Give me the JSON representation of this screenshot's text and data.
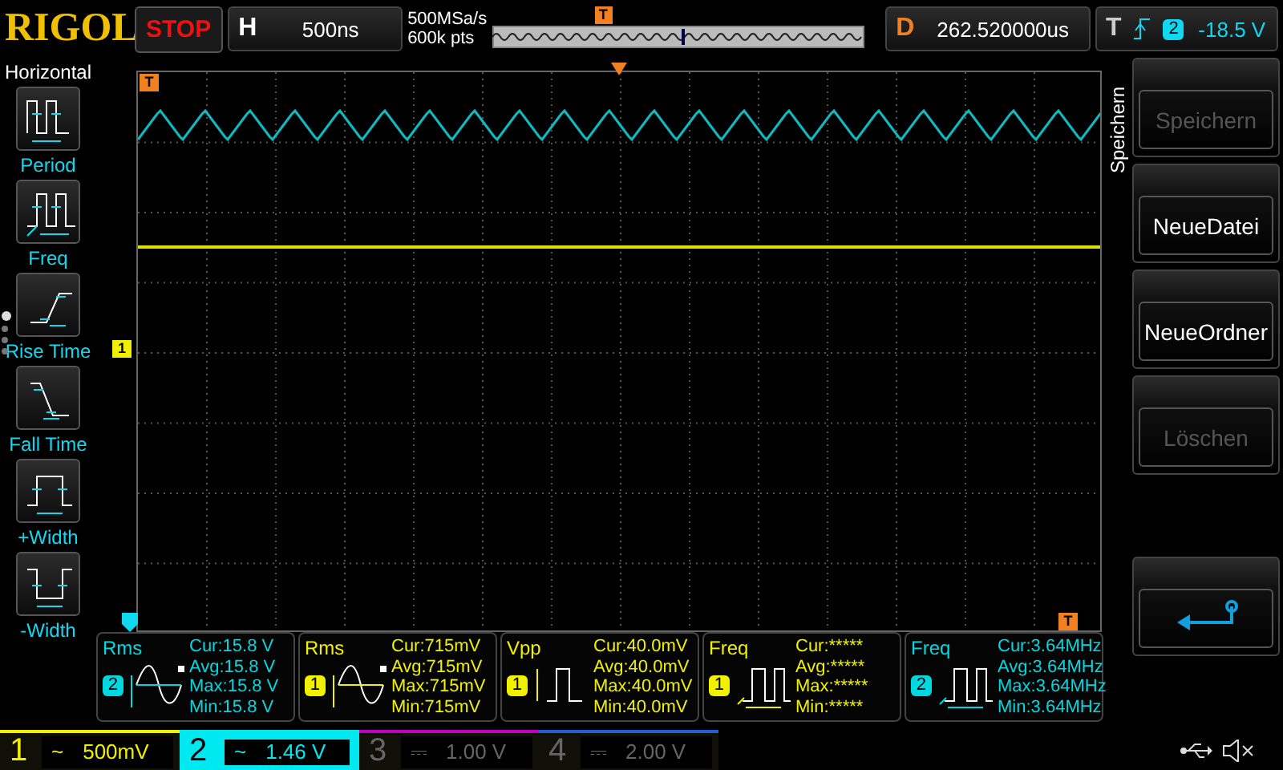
{
  "top_bar": {
    "brand": "RIGOL",
    "run_state": "STOP",
    "timebase": {
      "label": "H",
      "value": "500ns"
    },
    "sample_rate": "500MSa/s",
    "memory_depth": "600k pts",
    "overview_marker": "T",
    "delay": {
      "label": "D",
      "value": "262.520000us"
    },
    "trigger": {
      "label": "T",
      "source": "2",
      "level": "-18.5 V"
    }
  },
  "left_menu": {
    "title": "Horizontal",
    "items": [
      {
        "kind": "period",
        "label": "Period"
      },
      {
        "kind": "freq",
        "label": "Freq"
      },
      {
        "kind": "rise",
        "label": "Rise Time"
      },
      {
        "kind": "fall",
        "label": "Fall Time"
      },
      {
        "kind": "pwidth",
        "label": "+Width"
      },
      {
        "kind": "nwidth",
        "label": "-Width"
      }
    ],
    "pages": [
      {
        "selected": true
      },
      {
        "selected": false
      },
      {
        "selected": false
      },
      {
        "selected": false
      }
    ]
  },
  "grid": {
    "markers": [
      {
        "kind": "trigger",
        "label": "T"
      },
      {
        "kind": "channel",
        "label": "1",
        "color": "#f0f000"
      },
      {
        "kind": "trigger_level",
        "label": "T"
      }
    ]
  },
  "measurements": [
    {
      "kind": "rms",
      "name": "Rms",
      "channel": "2",
      "color": "#00d8e0",
      "cur": "Cur:15.8 V",
      "avg": "Avg:15.8 V",
      "max": "Max:15.8 V",
      "min": "Min:15.8 V"
    },
    {
      "kind": "rms",
      "name": "Rms",
      "channel": "1",
      "color": "#f0f000",
      "cur": "Cur:715mV",
      "avg": "Avg:715mV",
      "max": "Max:715mV",
      "min": "Min:715mV"
    },
    {
      "kind": "vpp",
      "name": "Vpp",
      "channel": "1",
      "color": "#f0f000",
      "cur": "Cur:40.0mV",
      "avg": "Avg:40.0mV",
      "max": "Max:40.0mV",
      "min": "Min:40.0mV"
    },
    {
      "kind": "freq",
      "name": "Freq",
      "channel": "1",
      "color": "#f0f000",
      "cur": "Cur:*****",
      "avg": "Avg:*****",
      "max": "Max:*****",
      "min": "Min:*****"
    },
    {
      "kind": "freq",
      "name": "Freq",
      "channel": "2",
      "color": "#00d8e0",
      "cur": "Cur:3.64MHz",
      "avg": "Avg:3.64MHz",
      "max": "Max:3.64MHz",
      "min": "Min:3.64MHz"
    }
  ],
  "right_menu": {
    "title": "Speichern",
    "buttons": [
      {
        "label": "Speichern",
        "disabled": true
      },
      {
        "label": "NeueDatei",
        "disabled": false
      },
      {
        "label": "NeueOrdner",
        "disabled": false
      },
      {
        "label": "Löschen",
        "disabled": true
      }
    ]
  },
  "channels": [
    {
      "number": "1",
      "coupling": "~",
      "scale": "500mV",
      "color": "#f0f000",
      "on": true,
      "selected": false
    },
    {
      "number": "2",
      "coupling": "~",
      "scale": "1.46 V",
      "color": "#00e8f0",
      "on": true,
      "selected": true
    },
    {
      "number": "3",
      "coupling": "⎓",
      "scale": "1.00 V",
      "color": "#c000c0",
      "on": false,
      "selected": false
    },
    {
      "number": "4",
      "coupling": "⎓",
      "scale": "2.00 V",
      "color": "#2060d0",
      "on": false,
      "selected": false
    }
  ]
}
